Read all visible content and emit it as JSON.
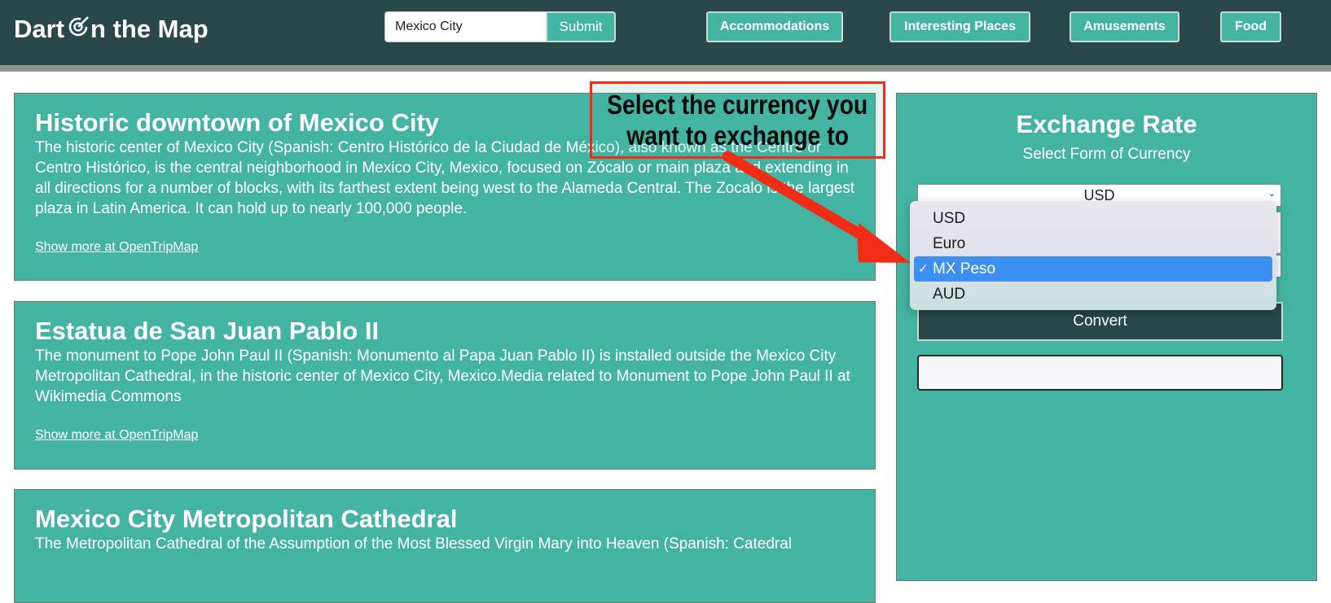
{
  "header": {
    "logo_before": "Dart",
    "logo_after": "n the Map",
    "search_value": "Mexico City",
    "submit_label": "Submit",
    "nav": [
      "Accommodations",
      "Interesting Places",
      "Amusements",
      "Food"
    ]
  },
  "places": [
    {
      "title": "Historic downtown of Mexico City",
      "description": "The historic center of Mexico City (Spanish: Centro Histórico de la Ciudad de México), also known as the Centro or Centro Histórico, is the central neighborhood in Mexico City, Mexico, focused on Zócalo or main plaza and extending in all directions for a number of blocks, with its farthest extent being west to the Alameda Central. The Zocalo is the largest plaza in Latin America. It can hold up to nearly 100,000 people.",
      "link": "Show more at OpenTripMap"
    },
    {
      "title": "Estatua de San Juan Pablo II",
      "description": "The monument to Pope John Paul II (Spanish: Monumento al Papa Juan Pablo II) is installed outside the Mexico City Metropolitan Cathedral, in the historic center of Mexico City, Mexico.Media related to Monument to Pope John Paul II at Wikimedia Commons",
      "link": "Show more at OpenTripMap"
    },
    {
      "title": "Mexico City Metropolitan Cathedral",
      "description": "The Metropolitan Cathedral of the Assumption of the Most Blessed Virgin Mary into Heaven (Spanish: Catedral",
      "link": ""
    }
  ],
  "exchange": {
    "title": "Exchange Rate",
    "subtitle": "Select Form of Currency",
    "from_currency": "USD",
    "convert_label": "Convert",
    "options": [
      "USD",
      "Euro",
      "MX Peso",
      "AUD"
    ],
    "selected_option": "MX Peso"
  },
  "annotation": {
    "line1": "Select the currency you",
    "line2": "want to exchange to"
  },
  "colors": {
    "header_bg": "#294847",
    "teal": "#44b4a2",
    "highlight": "#3e8ff2",
    "annotation_red": "#f12d17"
  }
}
